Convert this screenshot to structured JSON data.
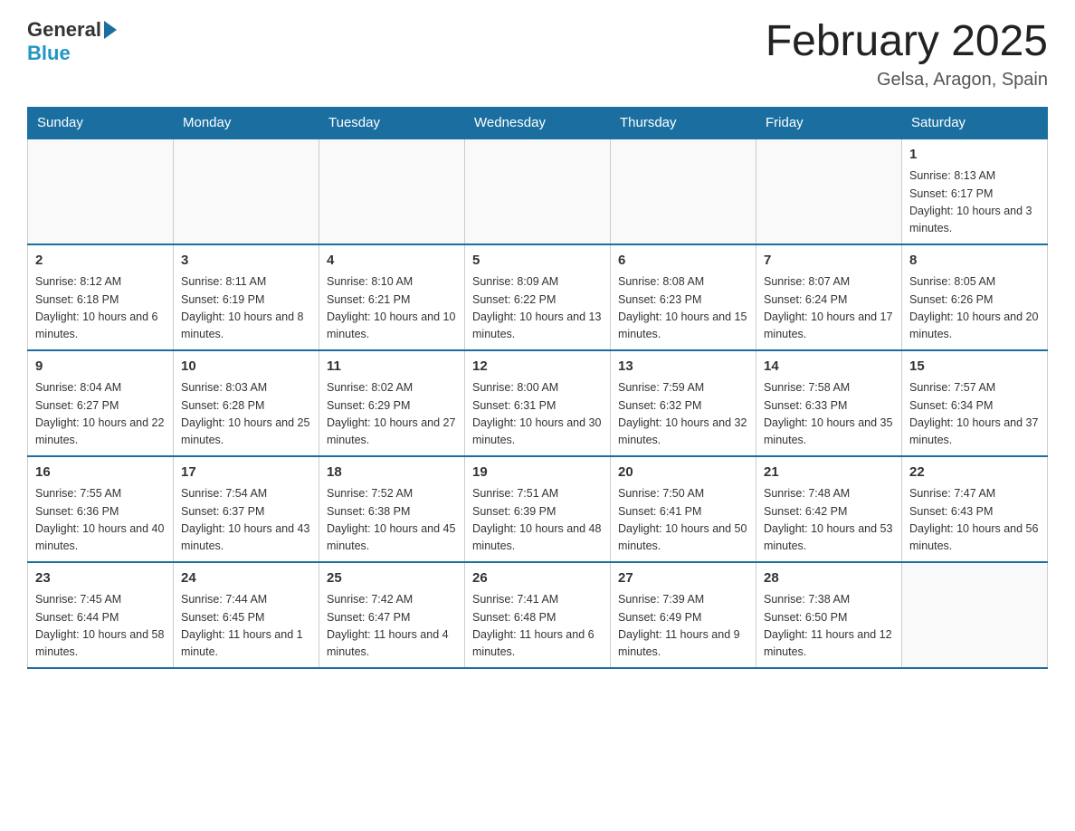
{
  "header": {
    "logo_general": "General",
    "logo_blue": "Blue",
    "month_title": "February 2025",
    "location": "Gelsa, Aragon, Spain"
  },
  "days_of_week": [
    "Sunday",
    "Monday",
    "Tuesday",
    "Wednesday",
    "Thursday",
    "Friday",
    "Saturday"
  ],
  "weeks": [
    [
      {
        "day": "",
        "sunrise": "",
        "sunset": "",
        "daylight": ""
      },
      {
        "day": "",
        "sunrise": "",
        "sunset": "",
        "daylight": ""
      },
      {
        "day": "",
        "sunrise": "",
        "sunset": "",
        "daylight": ""
      },
      {
        "day": "",
        "sunrise": "",
        "sunset": "",
        "daylight": ""
      },
      {
        "day": "",
        "sunrise": "",
        "sunset": "",
        "daylight": ""
      },
      {
        "day": "",
        "sunrise": "",
        "sunset": "",
        "daylight": ""
      },
      {
        "day": "1",
        "sunrise": "Sunrise: 8:13 AM",
        "sunset": "Sunset: 6:17 PM",
        "daylight": "Daylight: 10 hours and 3 minutes."
      }
    ],
    [
      {
        "day": "2",
        "sunrise": "Sunrise: 8:12 AM",
        "sunset": "Sunset: 6:18 PM",
        "daylight": "Daylight: 10 hours and 6 minutes."
      },
      {
        "day": "3",
        "sunrise": "Sunrise: 8:11 AM",
        "sunset": "Sunset: 6:19 PM",
        "daylight": "Daylight: 10 hours and 8 minutes."
      },
      {
        "day": "4",
        "sunrise": "Sunrise: 8:10 AM",
        "sunset": "Sunset: 6:21 PM",
        "daylight": "Daylight: 10 hours and 10 minutes."
      },
      {
        "day": "5",
        "sunrise": "Sunrise: 8:09 AM",
        "sunset": "Sunset: 6:22 PM",
        "daylight": "Daylight: 10 hours and 13 minutes."
      },
      {
        "day": "6",
        "sunrise": "Sunrise: 8:08 AM",
        "sunset": "Sunset: 6:23 PM",
        "daylight": "Daylight: 10 hours and 15 minutes."
      },
      {
        "day": "7",
        "sunrise": "Sunrise: 8:07 AM",
        "sunset": "Sunset: 6:24 PM",
        "daylight": "Daylight: 10 hours and 17 minutes."
      },
      {
        "day": "8",
        "sunrise": "Sunrise: 8:05 AM",
        "sunset": "Sunset: 6:26 PM",
        "daylight": "Daylight: 10 hours and 20 minutes."
      }
    ],
    [
      {
        "day": "9",
        "sunrise": "Sunrise: 8:04 AM",
        "sunset": "Sunset: 6:27 PM",
        "daylight": "Daylight: 10 hours and 22 minutes."
      },
      {
        "day": "10",
        "sunrise": "Sunrise: 8:03 AM",
        "sunset": "Sunset: 6:28 PM",
        "daylight": "Daylight: 10 hours and 25 minutes."
      },
      {
        "day": "11",
        "sunrise": "Sunrise: 8:02 AM",
        "sunset": "Sunset: 6:29 PM",
        "daylight": "Daylight: 10 hours and 27 minutes."
      },
      {
        "day": "12",
        "sunrise": "Sunrise: 8:00 AM",
        "sunset": "Sunset: 6:31 PM",
        "daylight": "Daylight: 10 hours and 30 minutes."
      },
      {
        "day": "13",
        "sunrise": "Sunrise: 7:59 AM",
        "sunset": "Sunset: 6:32 PM",
        "daylight": "Daylight: 10 hours and 32 minutes."
      },
      {
        "day": "14",
        "sunrise": "Sunrise: 7:58 AM",
        "sunset": "Sunset: 6:33 PM",
        "daylight": "Daylight: 10 hours and 35 minutes."
      },
      {
        "day": "15",
        "sunrise": "Sunrise: 7:57 AM",
        "sunset": "Sunset: 6:34 PM",
        "daylight": "Daylight: 10 hours and 37 minutes."
      }
    ],
    [
      {
        "day": "16",
        "sunrise": "Sunrise: 7:55 AM",
        "sunset": "Sunset: 6:36 PM",
        "daylight": "Daylight: 10 hours and 40 minutes."
      },
      {
        "day": "17",
        "sunrise": "Sunrise: 7:54 AM",
        "sunset": "Sunset: 6:37 PM",
        "daylight": "Daylight: 10 hours and 43 minutes."
      },
      {
        "day": "18",
        "sunrise": "Sunrise: 7:52 AM",
        "sunset": "Sunset: 6:38 PM",
        "daylight": "Daylight: 10 hours and 45 minutes."
      },
      {
        "day": "19",
        "sunrise": "Sunrise: 7:51 AM",
        "sunset": "Sunset: 6:39 PM",
        "daylight": "Daylight: 10 hours and 48 minutes."
      },
      {
        "day": "20",
        "sunrise": "Sunrise: 7:50 AM",
        "sunset": "Sunset: 6:41 PM",
        "daylight": "Daylight: 10 hours and 50 minutes."
      },
      {
        "day": "21",
        "sunrise": "Sunrise: 7:48 AM",
        "sunset": "Sunset: 6:42 PM",
        "daylight": "Daylight: 10 hours and 53 minutes."
      },
      {
        "day": "22",
        "sunrise": "Sunrise: 7:47 AM",
        "sunset": "Sunset: 6:43 PM",
        "daylight": "Daylight: 10 hours and 56 minutes."
      }
    ],
    [
      {
        "day": "23",
        "sunrise": "Sunrise: 7:45 AM",
        "sunset": "Sunset: 6:44 PM",
        "daylight": "Daylight: 10 hours and 58 minutes."
      },
      {
        "day": "24",
        "sunrise": "Sunrise: 7:44 AM",
        "sunset": "Sunset: 6:45 PM",
        "daylight": "Daylight: 11 hours and 1 minute."
      },
      {
        "day": "25",
        "sunrise": "Sunrise: 7:42 AM",
        "sunset": "Sunset: 6:47 PM",
        "daylight": "Daylight: 11 hours and 4 minutes."
      },
      {
        "day": "26",
        "sunrise": "Sunrise: 7:41 AM",
        "sunset": "Sunset: 6:48 PM",
        "daylight": "Daylight: 11 hours and 6 minutes."
      },
      {
        "day": "27",
        "sunrise": "Sunrise: 7:39 AM",
        "sunset": "Sunset: 6:49 PM",
        "daylight": "Daylight: 11 hours and 9 minutes."
      },
      {
        "day": "28",
        "sunrise": "Sunrise: 7:38 AM",
        "sunset": "Sunset: 6:50 PM",
        "daylight": "Daylight: 11 hours and 12 minutes."
      },
      {
        "day": "",
        "sunrise": "",
        "sunset": "",
        "daylight": ""
      }
    ]
  ]
}
